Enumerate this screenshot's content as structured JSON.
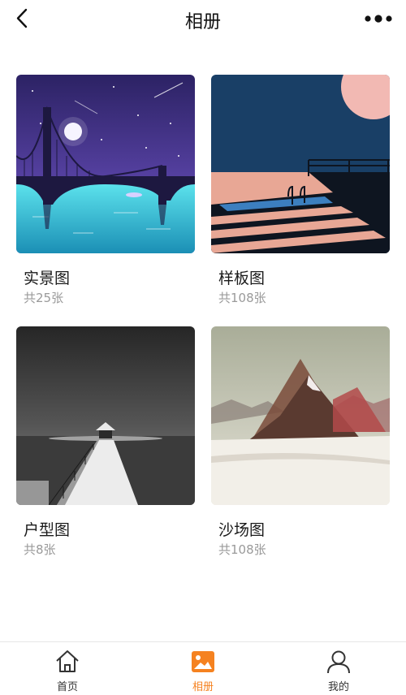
{
  "header": {
    "title": "相册",
    "back_icon": "chevron-left-icon",
    "more_icon": "more-dots-icon"
  },
  "albums": [
    {
      "title": "实景图",
      "count": "共25张",
      "image": "night-bridge-illustration"
    },
    {
      "title": "样板图",
      "count": "共108张",
      "image": "pool-stairs-illustration"
    },
    {
      "title": "户型图",
      "count": "共8张",
      "image": "snowy-pier-photo"
    },
    {
      "title": "沙场图",
      "count": "共108张",
      "image": "triangle-mountain-collage"
    }
  ],
  "tabbar": {
    "active": 1,
    "tabs": [
      {
        "label": "首页",
        "icon": "home-icon"
      },
      {
        "label": "相册",
        "icon": "photo-album-icon"
      },
      {
        "label": "我的",
        "icon": "user-icon"
      }
    ]
  },
  "colors": {
    "accent": "#f58220",
    "text": "#1a1a1a",
    "muted": "#9a9a9a"
  }
}
